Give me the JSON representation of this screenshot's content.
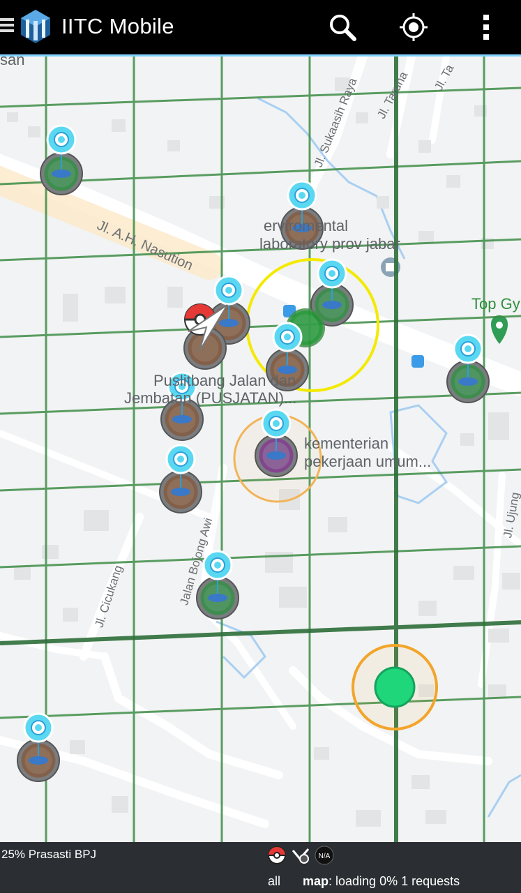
{
  "app": {
    "title": "IITC Mobile"
  },
  "toolbar": {
    "menu_icon": "hamburger-menu-icon",
    "logo_icon": "iitc-logo-icon",
    "search_icon": "search-icon",
    "locate_icon": "my-location-icon",
    "overflow_icon": "more-vert-icon"
  },
  "map": {
    "place_labels": {
      "enviro_line1": "erviromental",
      "enviro_line2": "laboratory prov jabar",
      "pusjatan_line1": "Puslitbang Jalan dan",
      "pusjatan_line2": "Jembatan (PUSJATAN)...",
      "kementerian_line1": "kementerian",
      "kementerian_line2": "pekerjaan umum...",
      "topgym": "Top Gy",
      "san": "san"
    },
    "street_labels": {
      "ah_nasution": "Jl. A.H. Nasution",
      "sukaasih": "Jl. Sukaasih Raya",
      "taruna": "Jl. Taruna",
      "ta": "Jl. Ta",
      "bojong_awi": "Jalan Bojong Awi",
      "cicukang": "Jl. Cicukang",
      "ujung": "Jl. Ujung"
    },
    "colors": {
      "grid": "#3e8d47",
      "grid_major": "#2e6f3a",
      "selection_ring": "#f3ea00",
      "portal_ring_green": "#0f9b26",
      "portal_ring_brown": "#8b4a1e",
      "portal_ring_purple": "#8a1a9a",
      "pokestop": "#5ad8f2",
      "player_dot": "#1fd67a",
      "player_ring": "#f2a52a"
    }
  },
  "status": {
    "left_text": "25% Prasasti BPJ",
    "layer_icons": [
      "pokeball-icon",
      "check-badge-icon",
      "na-badge-icon"
    ],
    "na_text": "N/A",
    "all_label": "all",
    "map_label": "map",
    "loading_text": ": loading 0% 1 requests"
  }
}
